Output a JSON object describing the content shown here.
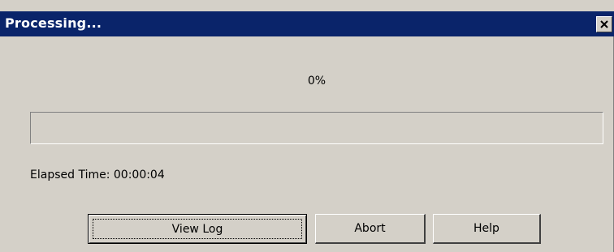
{
  "window": {
    "title": "Processing...",
    "close_icon": "close-icon"
  },
  "progress": {
    "percent_text": "0%",
    "fraction": 0
  },
  "status": {
    "elapsed": "Elapsed Time: 00:00:04"
  },
  "buttons": {
    "view_log": "View Log",
    "abort": "Abort",
    "help": "Help"
  },
  "colors": {
    "titlebar": "#0a246a",
    "dialog_face": "#d4d0c8",
    "title_text": "#ffffff"
  }
}
